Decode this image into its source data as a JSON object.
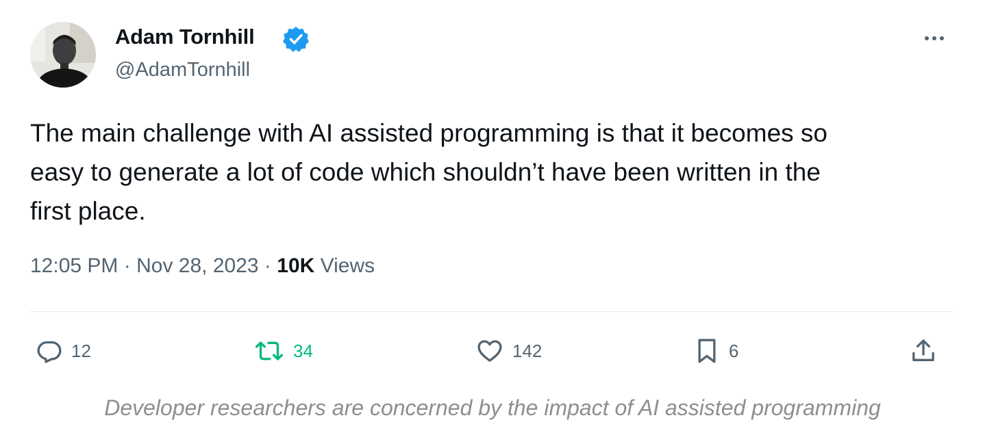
{
  "author": {
    "name": "Adam Tornhill",
    "handle": "@AdamTornhill",
    "verified": true,
    "badge_color": "#1d9bf0"
  },
  "tweet": {
    "text_lines": [
      "The main challenge with AI assisted programming is that it becomes so",
      "easy to generate a lot of code which shouldn’t have been written in the",
      "first place."
    ],
    "time": "12:05 PM",
    "separator": "·",
    "date": "Nov 28, 2023",
    "views_count": "10K",
    "views_label": "Views"
  },
  "actions": {
    "reply": {
      "icon": "reply-icon",
      "count": "12"
    },
    "retweet": {
      "icon": "retweet-icon",
      "count": "34",
      "color": "#00ba7c"
    },
    "like": {
      "icon": "heart-icon",
      "count": "142"
    },
    "bookmark": {
      "icon": "bookmark-icon",
      "count": "6"
    },
    "share": {
      "icon": "share-icon"
    }
  },
  "more_icon": "more-options-icon",
  "colors": {
    "text_primary": "#0f1419",
    "text_secondary": "#536471",
    "caption": "#8e8e8e"
  },
  "caption": "Developer researchers are concerned by the impact of AI assisted programming"
}
